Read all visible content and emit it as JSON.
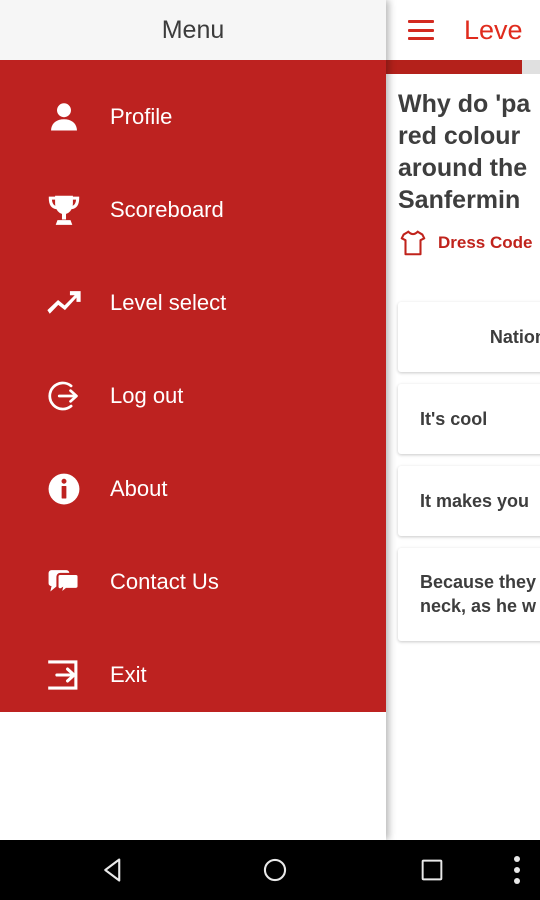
{
  "drawer": {
    "title": "Menu",
    "items": [
      {
        "label": "Profile",
        "icon": "user-icon"
      },
      {
        "label": "Scoreboard",
        "icon": "trophy-icon"
      },
      {
        "label": "Level select",
        "icon": "trending-up-icon"
      },
      {
        "label": "Log out",
        "icon": "logout-icon"
      },
      {
        "label": "About",
        "icon": "info-icon"
      },
      {
        "label": "Contact Us",
        "icon": "chat-bubbles-icon"
      },
      {
        "label": "Exit",
        "icon": "exit-icon"
      }
    ],
    "background_color": "#bd2220",
    "header_color": "#f6f6f6"
  },
  "content": {
    "appbar": {
      "menu_icon": "hamburger-icon",
      "title": "Leve"
    },
    "progress": {
      "percent": 88
    },
    "question": {
      "line1": "Why do 'pa",
      "line2": "red colour",
      "line3": "around the",
      "line4": "Sanfermin",
      "category_icon": "tshirt-icon",
      "category_label": "Dress Code",
      "category_color": "#c0231c"
    },
    "answers": [
      {
        "line1": "National Anth",
        "line2": "",
        "align": "center"
      },
      {
        "line1": "It's cool",
        "line2": "",
        "align": "left"
      },
      {
        "line1": "It makes you ",
        "line2": "",
        "align": "left"
      },
      {
        "line1": "Because they",
        "line2": "neck, as he w",
        "align": "left"
      }
    ]
  },
  "navbar": {
    "back": "back-triangle-icon",
    "home": "home-circle-icon",
    "recents": "recents-square-icon",
    "overflow": "overflow-dots-icon"
  }
}
